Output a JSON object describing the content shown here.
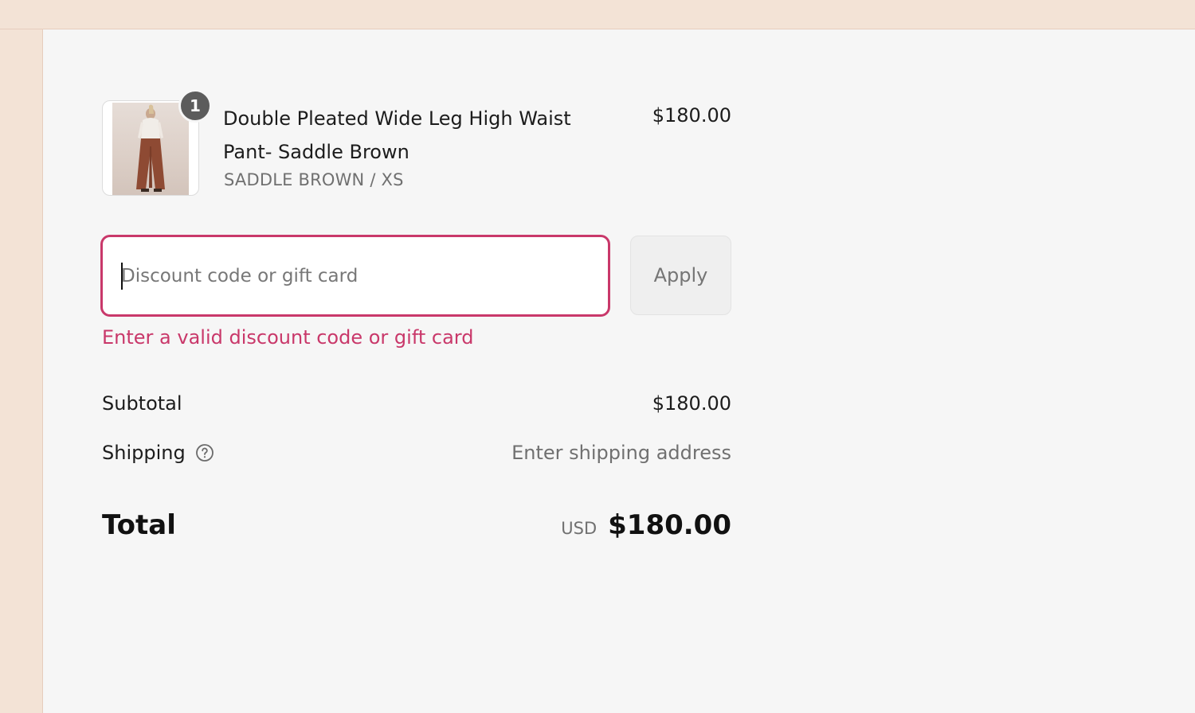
{
  "product": {
    "name": "Double Pleated Wide Leg High Waist Pant- Saddle Brown",
    "variant": "SADDLE BROWN / XS",
    "price": "$180.00",
    "quantity": "1"
  },
  "discount": {
    "placeholder": "Discount code or gift card",
    "value": "",
    "apply_label": "Apply",
    "error": "Enter a valid discount code or gift card"
  },
  "summary": {
    "subtotal_label": "Subtotal",
    "subtotal_value": "$180.00",
    "shipping_label": "Shipping",
    "shipping_value": "Enter shipping address",
    "total_label": "Total",
    "currency": "USD",
    "total_value": "$180.00"
  },
  "colors": {
    "accent_error": "#c9386a",
    "side_background": "#f3e3d6",
    "panel_background": "#f6f6f6"
  },
  "icons": {
    "badge": "quantity-badge",
    "help": "question-circle-icon"
  }
}
